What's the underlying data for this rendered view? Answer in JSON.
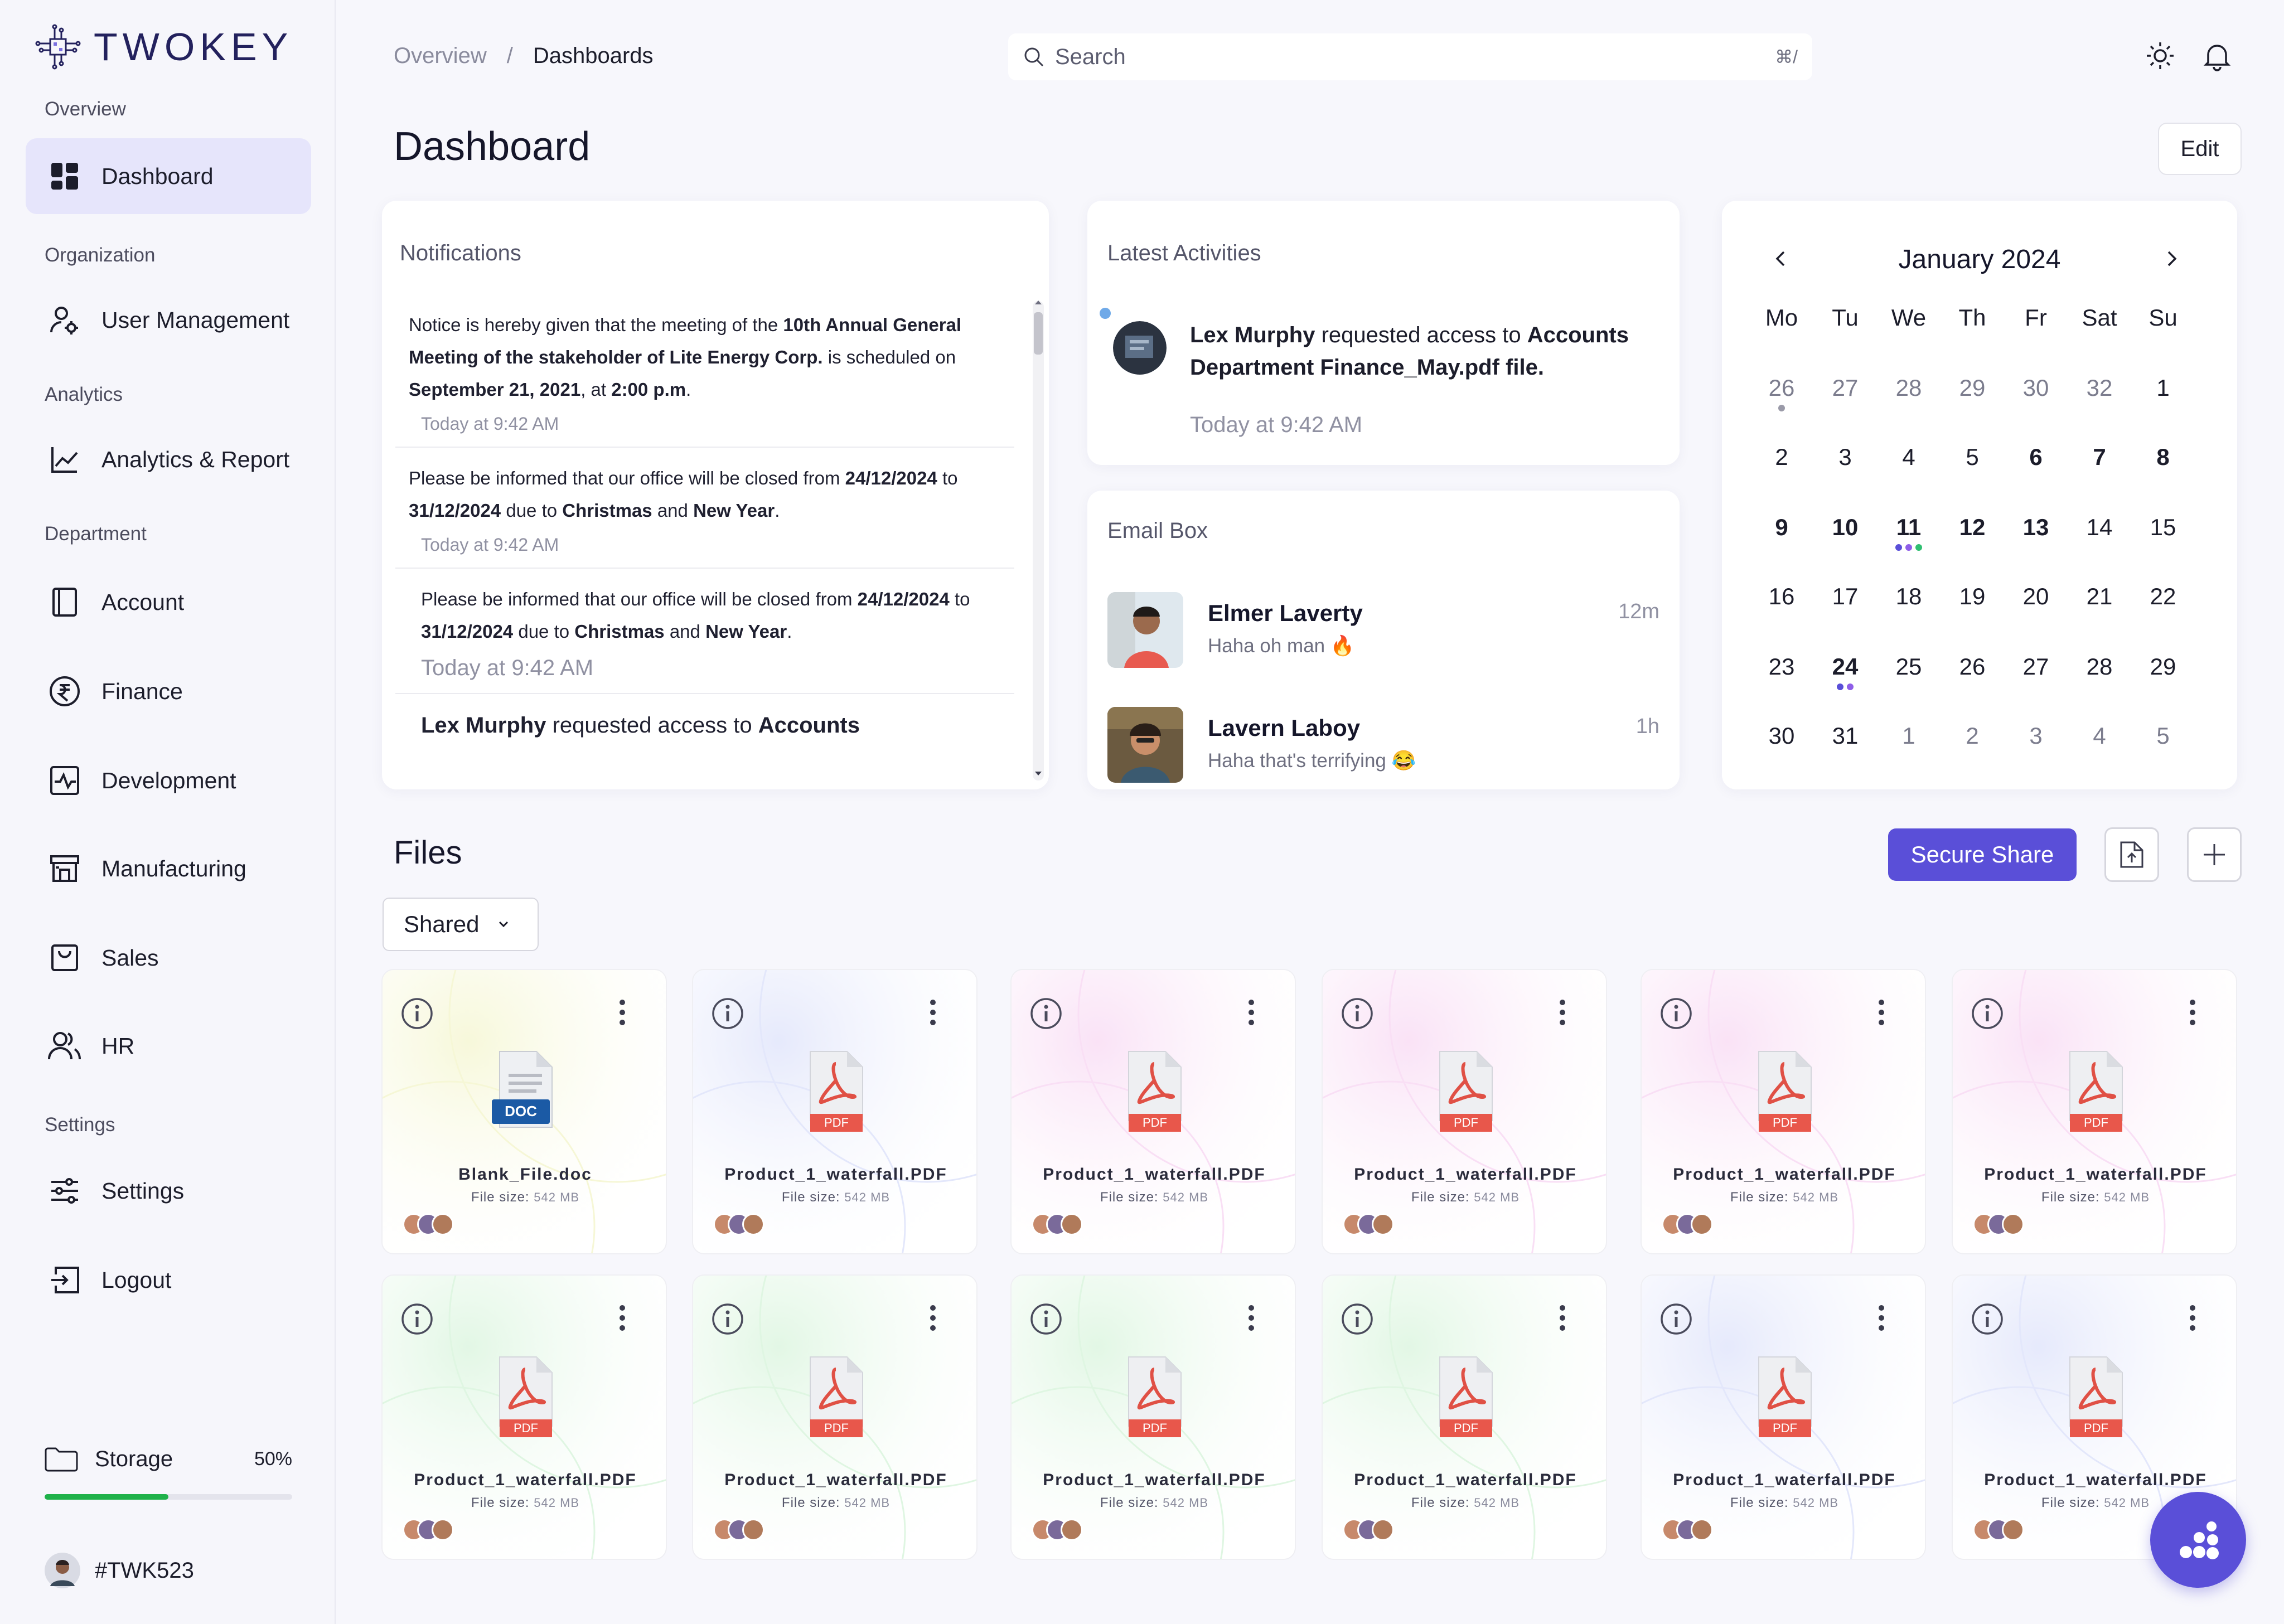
{
  "brand": {
    "name": "TWOKEY"
  },
  "colors": {
    "accent": "#5a4fd8",
    "storage_bar": "#1fb14a",
    "active_nav_bg": "#e6e5fb"
  },
  "sidebar": {
    "sections": [
      {
        "label": "Overview"
      },
      {
        "label": "Organization"
      },
      {
        "label": "Analytics"
      },
      {
        "label": "Department"
      },
      {
        "label": "Settings"
      }
    ],
    "items": [
      {
        "label": "Dashboard",
        "icon": "dashboard-icon",
        "active": true
      },
      {
        "label": "User Management",
        "icon": "user-gear-icon"
      },
      {
        "label": "Analytics & Report",
        "icon": "chart-line-icon"
      },
      {
        "label": "Account",
        "icon": "book-icon"
      },
      {
        "label": "Finance",
        "icon": "rupee-icon"
      },
      {
        "label": "Development",
        "icon": "pulse-icon"
      },
      {
        "label": "Manufacturing",
        "icon": "factory-icon"
      },
      {
        "label": "Sales",
        "icon": "bag-icon"
      },
      {
        "label": "HR",
        "icon": "users-icon"
      },
      {
        "label": "Settings",
        "icon": "sliders-icon"
      },
      {
        "label": "Logout",
        "icon": "logout-icon"
      }
    ],
    "storage": {
      "label": "Storage",
      "percent_label": "50%",
      "percent": 0.5
    },
    "user": {
      "id": "#TWK523"
    }
  },
  "header": {
    "breadcrumb": [
      "Overview",
      "Dashboards"
    ],
    "breadcrumb_sep": "/",
    "search": {
      "placeholder": "Search",
      "shortcut": "⌘/"
    }
  },
  "page": {
    "title": "Dashboard",
    "edit_label": "Edit"
  },
  "notifications": {
    "title": "Notifications",
    "items": [
      {
        "segments": [
          [
            "Notice is hereby given that the meeting of the ",
            false
          ],
          [
            "10th Annual General Meeting of the stakeholder of Lite Energy Corp.",
            true
          ],
          [
            " is scheduled on ",
            false
          ],
          [
            "September 21, 2021",
            true
          ],
          [
            ", at ",
            false
          ],
          [
            "2:00 p.m",
            true
          ],
          [
            ".",
            false
          ]
        ],
        "time": "Today at 9:42 AM"
      },
      {
        "segments": [
          [
            "Please be informed that our office will be closed from ",
            false
          ],
          [
            "24/12/2024",
            true
          ],
          [
            " to ",
            false
          ],
          [
            "31/12/2024",
            true
          ],
          [
            " due to ",
            false
          ],
          [
            "Christmas",
            true
          ],
          [
            " and ",
            false
          ],
          [
            "New Year",
            true
          ],
          [
            ".",
            false
          ]
        ],
        "time": "Today at 9:42 AM"
      },
      {
        "segments": [
          [
            "Please be informed that our office will be closed from ",
            false
          ],
          [
            "24/12/2024",
            true
          ],
          [
            " to ",
            false
          ],
          [
            "31/12/2024",
            true
          ],
          [
            " due to ",
            false
          ],
          [
            "Christmas",
            true
          ],
          [
            " and ",
            false
          ],
          [
            "New Year",
            true
          ],
          [
            ".",
            false
          ]
        ],
        "time": "Today at 9:42 AM"
      },
      {
        "segments": [
          [
            "Lex Murphy",
            true
          ],
          [
            " requested access to ",
            false
          ],
          [
            "Accounts",
            true
          ]
        ],
        "time": ""
      }
    ]
  },
  "activities": {
    "title": "Latest Activities",
    "item": {
      "actor": "Lex Murphy",
      "action": " requested access to ",
      "target": "Accounts Department Finance_May.pdf file.",
      "time": "Today at 9:42 AM"
    }
  },
  "email_box": {
    "title": "Email Box",
    "items": [
      {
        "name": "Elmer Laverty",
        "message": "Haha oh man 🔥",
        "time": "12m"
      },
      {
        "name": "Lavern Laboy",
        "message": "Haha that's terrifying 😂",
        "time": "1h"
      }
    ]
  },
  "calendar": {
    "title": "January 2024",
    "weekdays": [
      "Mo",
      "Tu",
      "We",
      "Th",
      "Fr",
      "Sat",
      "Su"
    ],
    "weeks": [
      [
        "26",
        "27",
        "28",
        "29",
        "30",
        "32",
        "1"
      ],
      [
        "2",
        "3",
        "4",
        "5",
        "6",
        "7",
        "8"
      ],
      [
        "9",
        "10",
        "11",
        "12",
        "13",
        "14",
        "15"
      ],
      [
        "16",
        "17",
        "18",
        "19",
        "20",
        "21",
        "22"
      ],
      [
        "23",
        "24",
        "25",
        "26",
        "27",
        "28",
        "29"
      ],
      [
        "30",
        "31",
        "1",
        "2",
        "3",
        "4",
        "5"
      ]
    ],
    "muted": [
      [
        0,
        0
      ],
      [
        0,
        1
      ],
      [
        0,
        2
      ],
      [
        0,
        3
      ],
      [
        0,
        4
      ],
      [
        0,
        5
      ],
      [
        5,
        2
      ],
      [
        5,
        3
      ],
      [
        5,
        4
      ],
      [
        5,
        5
      ],
      [
        5,
        6
      ]
    ],
    "bold": [
      [
        1,
        4
      ],
      [
        1,
        5
      ],
      [
        1,
        6
      ],
      [
        2,
        0
      ],
      [
        2,
        1
      ],
      [
        2,
        2
      ],
      [
        2,
        3
      ],
      [
        2,
        4
      ],
      [
        4,
        1
      ]
    ],
    "event_dots": [
      {
        "cell": [
          0,
          0
        ],
        "colors": [
          "#9a9aa8"
        ]
      },
      {
        "cell": [
          2,
          2
        ],
        "colors": [
          "#5a4fd8",
          "#8f5ee8",
          "#2fbf71"
        ]
      },
      {
        "cell": [
          4,
          1
        ],
        "colors": [
          "#5a4fd8",
          "#8f5ee8"
        ]
      }
    ]
  },
  "files": {
    "title": "Files",
    "secure_share_label": "Secure Share",
    "filter_label": "Shared",
    "size_label": "File size:",
    "items": [
      {
        "name": "Blank_File.doc",
        "size": "542 MB",
        "type": "DOC",
        "tint": "#f6f7d6"
      },
      {
        "name": "Product_1_waterfall.PDF",
        "size": "542 MB",
        "type": "PDF",
        "tint": "#e3e7fb"
      },
      {
        "name": "Product_1_waterfall.PDF",
        "size": "542 MB",
        "type": "PDF",
        "tint": "#f9dff5"
      },
      {
        "name": "Product_1_waterfall.PDF",
        "size": "542 MB",
        "type": "PDF",
        "tint": "#f9dff5"
      },
      {
        "name": "Product_1_waterfall.PDF",
        "size": "542 MB",
        "type": "PDF",
        "tint": "#f9dff5"
      },
      {
        "name": "Product_1_waterfall.PDF",
        "size": "542 MB",
        "type": "PDF",
        "tint": "#f9dff5"
      },
      {
        "name": "Product_1_waterfall.PDF",
        "size": "542 MB",
        "type": "PDF",
        "tint": "#dff6e2"
      },
      {
        "name": "Product_1_waterfall.PDF",
        "size": "542 MB",
        "type": "PDF",
        "tint": "#dff6e2"
      },
      {
        "name": "Product_1_waterfall.PDF",
        "size": "542 MB",
        "type": "PDF",
        "tint": "#dff6e2"
      },
      {
        "name": "Product_1_waterfall.PDF",
        "size": "542 MB",
        "type": "PDF",
        "tint": "#dff6e2"
      },
      {
        "name": "Product_1_waterfall.PDF",
        "size": "542 MB",
        "type": "PDF",
        "tint": "#e3e7fb"
      },
      {
        "name": "Product_1_waterfall.PDF",
        "size": "542 MB",
        "type": "PDF",
        "tint": "#e3e7fb"
      }
    ]
  }
}
